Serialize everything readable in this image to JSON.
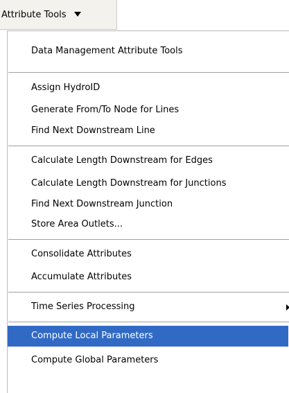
{
  "menubar": {
    "title": "Attribute Tools",
    "arrow_icon": "caret-down-icon"
  },
  "menu": {
    "items": [
      {
        "label": "Data Management Attribute Tools"
      },
      {
        "label": "Assign HydroID"
      },
      {
        "label": "Generate From/To Node for Lines"
      },
      {
        "label": "Find Next Downstream Line"
      },
      {
        "label": "Calculate Length Downstream for Edges"
      },
      {
        "label": "Calculate Length Downstream for Junctions"
      },
      {
        "label": "Find Next Downstream Junction"
      },
      {
        "label": "Store Area Outlets..."
      },
      {
        "label": "Consolidate Attributes"
      },
      {
        "label": "Accumulate Attributes"
      },
      {
        "label": "Time Series Processing",
        "submenu_icon": "chevron-right-icon"
      },
      {
        "label": "Compute Local Parameters",
        "state": "selected"
      },
      {
        "label": "Compute Global Parameters"
      }
    ]
  },
  "colors": {
    "selection_background": "#316ac5",
    "selection_text": "#ffffff",
    "menubar_background": "#f3f2ec"
  }
}
